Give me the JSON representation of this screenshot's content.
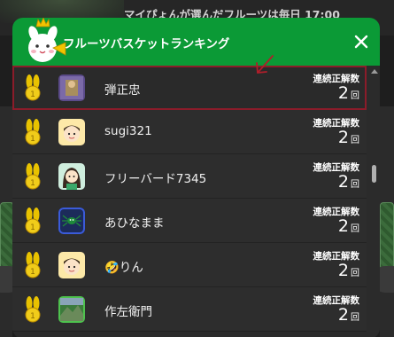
{
  "background": {
    "banner_text": "マイぴょんが選んだフルーツは毎日 17:00"
  },
  "modal": {
    "title": "フルーツバスケットランキング",
    "close_icon": "close-icon",
    "mascot_icon": "rabbit-mascot-icon",
    "annotation_arrow": "red-hand-drawn-arrow",
    "accent_color": "#0b9a36",
    "highlight_color": "#8b1c2a",
    "streak_label": "連続正解数",
    "streak_unit": "回"
  },
  "rankings": [
    {
      "name": "弾正忠",
      "streak": "2",
      "medal_icon": "gold-rabbit-medal-icon",
      "avatar_icon": "game-thumbnail-avatar",
      "highlighted": true
    },
    {
      "name": "sugi321",
      "streak": "2",
      "medal_icon": "gold-rabbit-medal-icon",
      "avatar_icon": "boy-face-avatar",
      "highlighted": false
    },
    {
      "name": "フリーバード7345",
      "streak": "2",
      "medal_icon": "gold-rabbit-medal-icon",
      "avatar_icon": "woman-face-avatar",
      "highlighted": false
    },
    {
      "name": "あひなまま",
      "streak": "2",
      "medal_icon": "gold-rabbit-medal-icon",
      "avatar_icon": "spider-avatar",
      "highlighted": false
    },
    {
      "name": "🤣りん",
      "streak": "2",
      "medal_icon": "gold-rabbit-medal-icon",
      "avatar_icon": "boy-face-avatar",
      "highlighted": false
    },
    {
      "name": "作左衛門",
      "streak": "2",
      "medal_icon": "gold-rabbit-medal-icon",
      "avatar_icon": "landscape-avatar",
      "highlighted": false
    }
  ]
}
